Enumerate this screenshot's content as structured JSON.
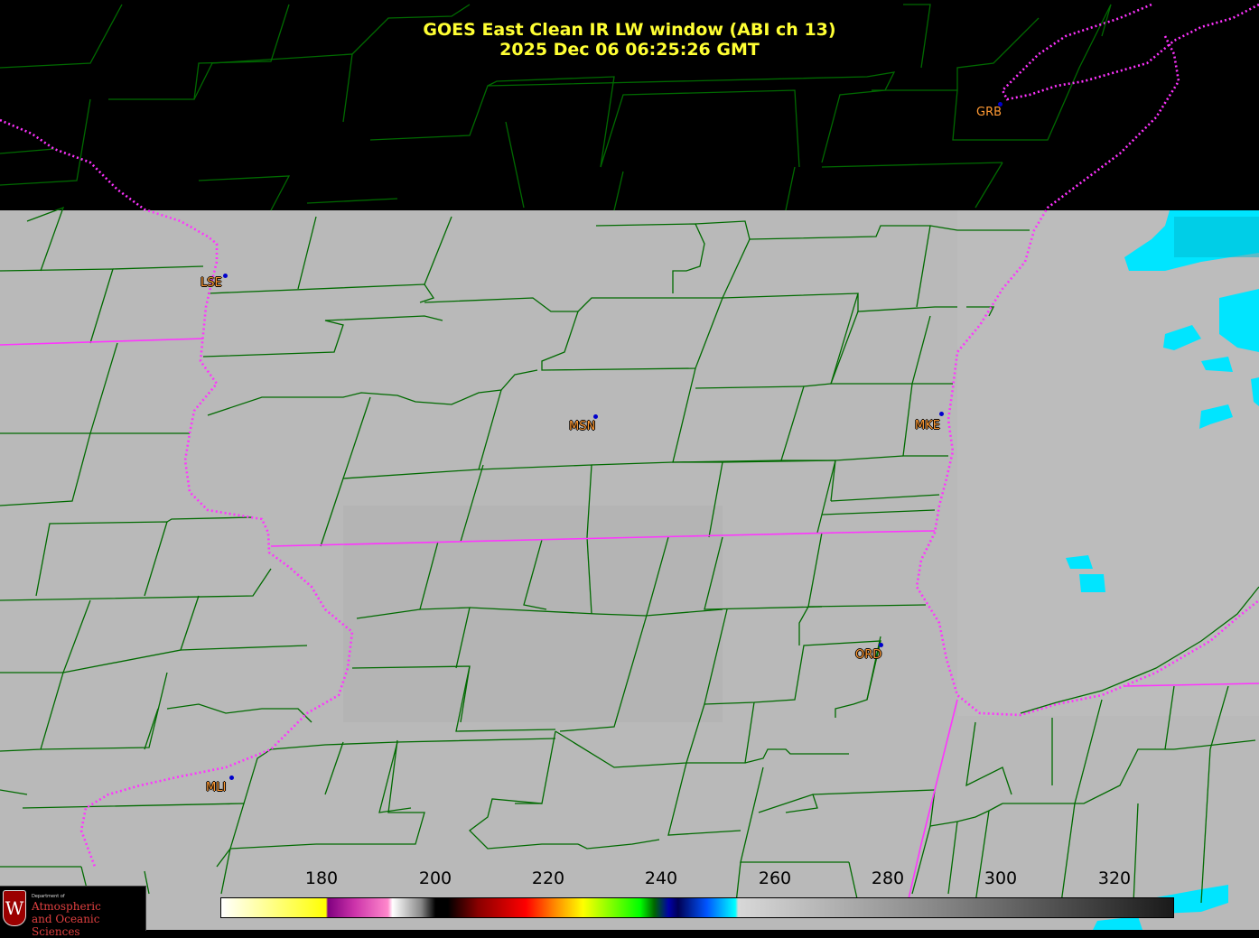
{
  "title": {
    "line1": "GOES East Clean IR LW window (ABI ch 13)",
    "line2": "2025 Dec 06  06:25:26 GMT"
  },
  "cities": [
    {
      "code": "GRB"
    },
    {
      "code": "LSE"
    },
    {
      "code": "MSN"
    },
    {
      "code": "MKE"
    },
    {
      "code": "ORD"
    },
    {
      "code": "MLI"
    }
  ],
  "colorbar": {
    "ticks": [
      "180",
      "200",
      "220",
      "240",
      "260",
      "280",
      "300",
      "320"
    ]
  },
  "logo": {
    "dept": "Department of",
    "line1": "Atmospheric",
    "line2": "and Oceanic Sciences",
    "crest": "W"
  },
  "colors": {
    "title": "#ffff33",
    "city_label": "#ff9933",
    "county_lines": "#006600",
    "state_lines": "#ff33ff",
    "background_ir": "#b8b8b8",
    "cold_cloud": "#00e5ff"
  }
}
